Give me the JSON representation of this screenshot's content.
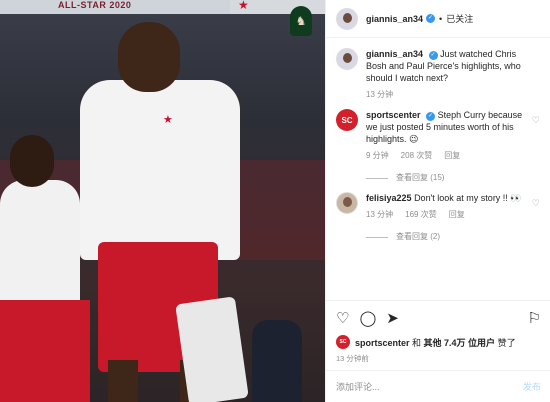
{
  "photo": {
    "banner_text": "ALL-STAR 2020"
  },
  "header": {
    "username": "giannis_an34",
    "separator": "•",
    "follow_label": "已关注"
  },
  "caption": {
    "username": "giannis_an34",
    "text": "Just watched Chris Bosh and Paul Pierce's highlights, who should I watch next?",
    "time": "13 分钟"
  },
  "comments": [
    {
      "username": "sportscenter",
      "avatar_text": "SC",
      "text": "Steph Curry because we just posted 5 minutes worth of his highlights. 😉",
      "time": "9 分钟",
      "likes": "208 次赞",
      "reply_label": "回复",
      "view_replies": "查看回复 (15)"
    },
    {
      "username": "felisiya225",
      "text": "Don't look at my story !! 👀",
      "time": "13 分钟",
      "likes": "169 次赞",
      "reply_label": "回复",
      "view_replies": "查看回复 (2)"
    }
  ],
  "icons": {
    "like": "♡",
    "comment": "◯",
    "share": "➤",
    "save": "⚐",
    "comment_heart": "♡"
  },
  "likes_summary": {
    "avatar_text": "SC",
    "prefix_user": "sportscenter",
    "text_and": " 和 ",
    "others": "其他 7.4万 位用户",
    "suffix": " 赞了"
  },
  "time_ago": "13 分钟前",
  "add_comment": {
    "placeholder": "添加评论...",
    "post_label": "发布"
  },
  "colors": {
    "verified": "#3897f0",
    "sportscenter_red": "#d4202b",
    "post_disabled": "#b3dbff"
  }
}
